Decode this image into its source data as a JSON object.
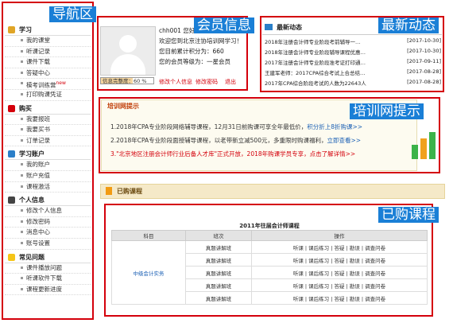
{
  "annotations": {
    "nav": "导航区",
    "member": "会员信息",
    "news": "最新动态",
    "training": "培训网提示",
    "purchased": "已购课程"
  },
  "sidebar": {
    "sections": [
      {
        "title": "学习",
        "icon": "pencil-icon",
        "items": [
          "我的课堂",
          "听课记录",
          "课件下载",
          "答疑中心",
          "模考训练营",
          "打印购课凭证"
        ],
        "badge_item": 4,
        "badge": "new"
      },
      {
        "title": "购买",
        "icon": "cart-icon",
        "items": [
          "我要报班",
          "我要买书",
          "订单记录"
        ]
      },
      {
        "title": "学习账户",
        "icon": "book-icon",
        "items": [
          "我的账户",
          "账户充值",
          "课程激活"
        ]
      },
      {
        "title": "个人信息",
        "icon": "user-icon",
        "items": [
          "修改个人信息",
          "修改密码",
          "消息中心",
          "账号设置"
        ]
      },
      {
        "title": "常见问题",
        "icon": "bulb-icon",
        "items": [
          "课件播放问题",
          "听课软件下载",
          "课程更新进度"
        ]
      }
    ]
  },
  "member": {
    "line1": "chh001 您好！",
    "line2": "欢迎您到北京注协培训网学习！",
    "line3": "您目前累计积分为：660",
    "line4": "您的会员等级为：一星会员",
    "progress_label": "信息完整度：60 %",
    "progress": 0.6,
    "links": [
      "修改个人信息",
      "修改密码",
      "退出"
    ]
  },
  "news": {
    "title": "最新动态",
    "items": [
      {
        "text": "2018年注册会计师专业阶段考前辅导一…",
        "date": "[2017-10-30]"
      },
      {
        "text": "2018年注册会计师专业阶段辅导课程优惠…",
        "date": "[2017-10-30]"
      },
      {
        "text": "2017年注册会计师专业阶段准考证打印通…",
        "date": "[2017-09-11]"
      },
      {
        "text": "王建军老师：2017CPA综合考试上合总结…",
        "date": "[2017-08-28]"
      },
      {
        "text": "2017年CPA综合阶段考试的人数为22643人",
        "date": "[2017-08-28]"
      }
    ]
  },
  "training": {
    "title": "培训网提示",
    "lines": [
      {
        "text": "1.2018年CPA专业阶段网络辅导课程，12月31日前购课可享全年最低价，",
        "link": "积分折上8折购课>>"
      },
      {
        "text": "2.2018年CPA专业阶段面授辅导课程，以老带新立减500元，多重限时购课福利，",
        "link": "立即查看>>"
      },
      {
        "text": "3.\"北京地区注册会计师行业后备人才库\"正式开放，2018年购课学员专享，点击了解详情>>",
        "link": ""
      }
    ]
  },
  "purchased": {
    "bar_title": "已购课程",
    "table_title": "2011年往届会计师课程",
    "headers": [
      "科目",
      "班次",
      "操作"
    ],
    "subject": "中级会计实务",
    "rows": [
      {
        "class": "真题讲解班",
        "ops": "听课 | 课后练习 | 答疑 | 勘误 | 调查问卷"
      },
      {
        "class": "真题讲解班",
        "ops": "听课 | 课后练习 | 答疑 | 勘误 | 调查问卷"
      },
      {
        "class": "真题讲解班",
        "ops": "听课 | 课后练习 | 答疑 | 勘误 | 调查问卷"
      },
      {
        "class": "真题讲解班",
        "ops": "听课 | 课后练习 | 答疑 | 勘误 | 调查问卷"
      },
      {
        "class": "真题讲解班",
        "ops": "听课 | 课后练习 | 答疑 | 勘误 | 调查问卷"
      }
    ]
  }
}
